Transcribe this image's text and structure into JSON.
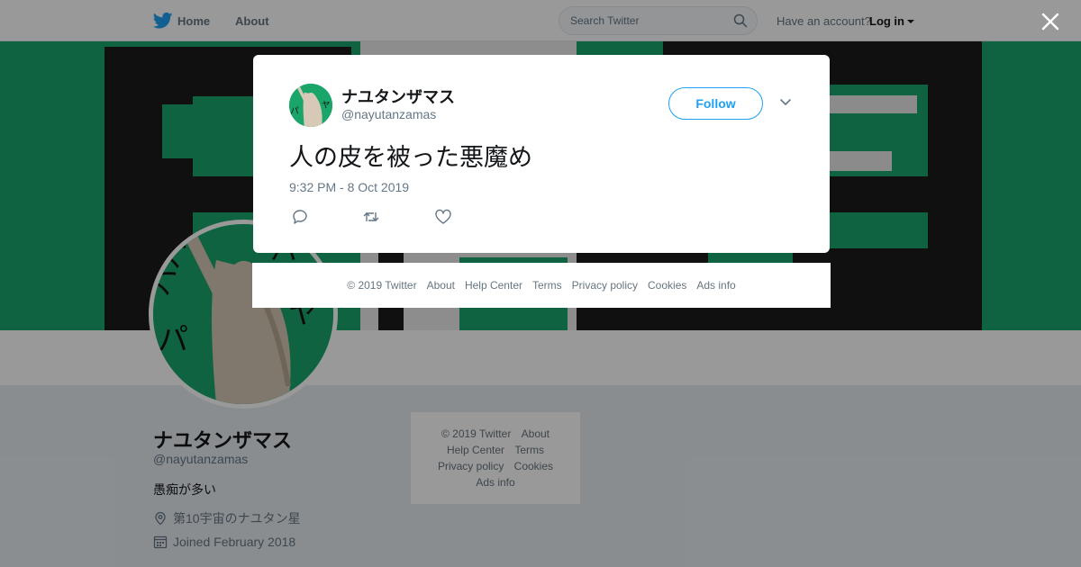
{
  "nav": {
    "home": "Home",
    "about": "About",
    "search_placeholder": "Search Twitter",
    "have_account": "Have an account?",
    "login": "Log in"
  },
  "profile": {
    "name": "ナユタンザマス",
    "handle": "@nayutanzamas",
    "bio": "愚痴が多い",
    "location": "第10宇宙のナユタン星",
    "joined": "Joined February 2018"
  },
  "side_footer": {
    "links": [
      "© 2019 Twitter",
      "About",
      "Help Center",
      "Terms",
      "Privacy policy",
      "Cookies",
      "Ads info"
    ]
  },
  "tweet": {
    "author_name": "ナユタンザマス",
    "author_handle": "@nayutanzamas",
    "follow_label": "Follow",
    "text": "人の皮を被った悪魔め",
    "timestamp": "9:32 PM - 8 Oct 2019"
  },
  "footer": {
    "links": [
      "© 2019 Twitter",
      "About",
      "Help Center",
      "Terms",
      "Privacy policy",
      "Cookies",
      "Ads info"
    ]
  },
  "icons": {
    "brand": "twitter-bird-icon",
    "search": "search-icon",
    "close": "close-icon",
    "reply": "reply-icon",
    "retweet": "retweet-icon",
    "like": "heart-icon",
    "location": "location-pin-icon",
    "calendar": "calendar-icon"
  },
  "colors": {
    "brand_blue": "#1da1f2",
    "banner_green": "#1aa56b",
    "text_secondary": "#657786"
  }
}
